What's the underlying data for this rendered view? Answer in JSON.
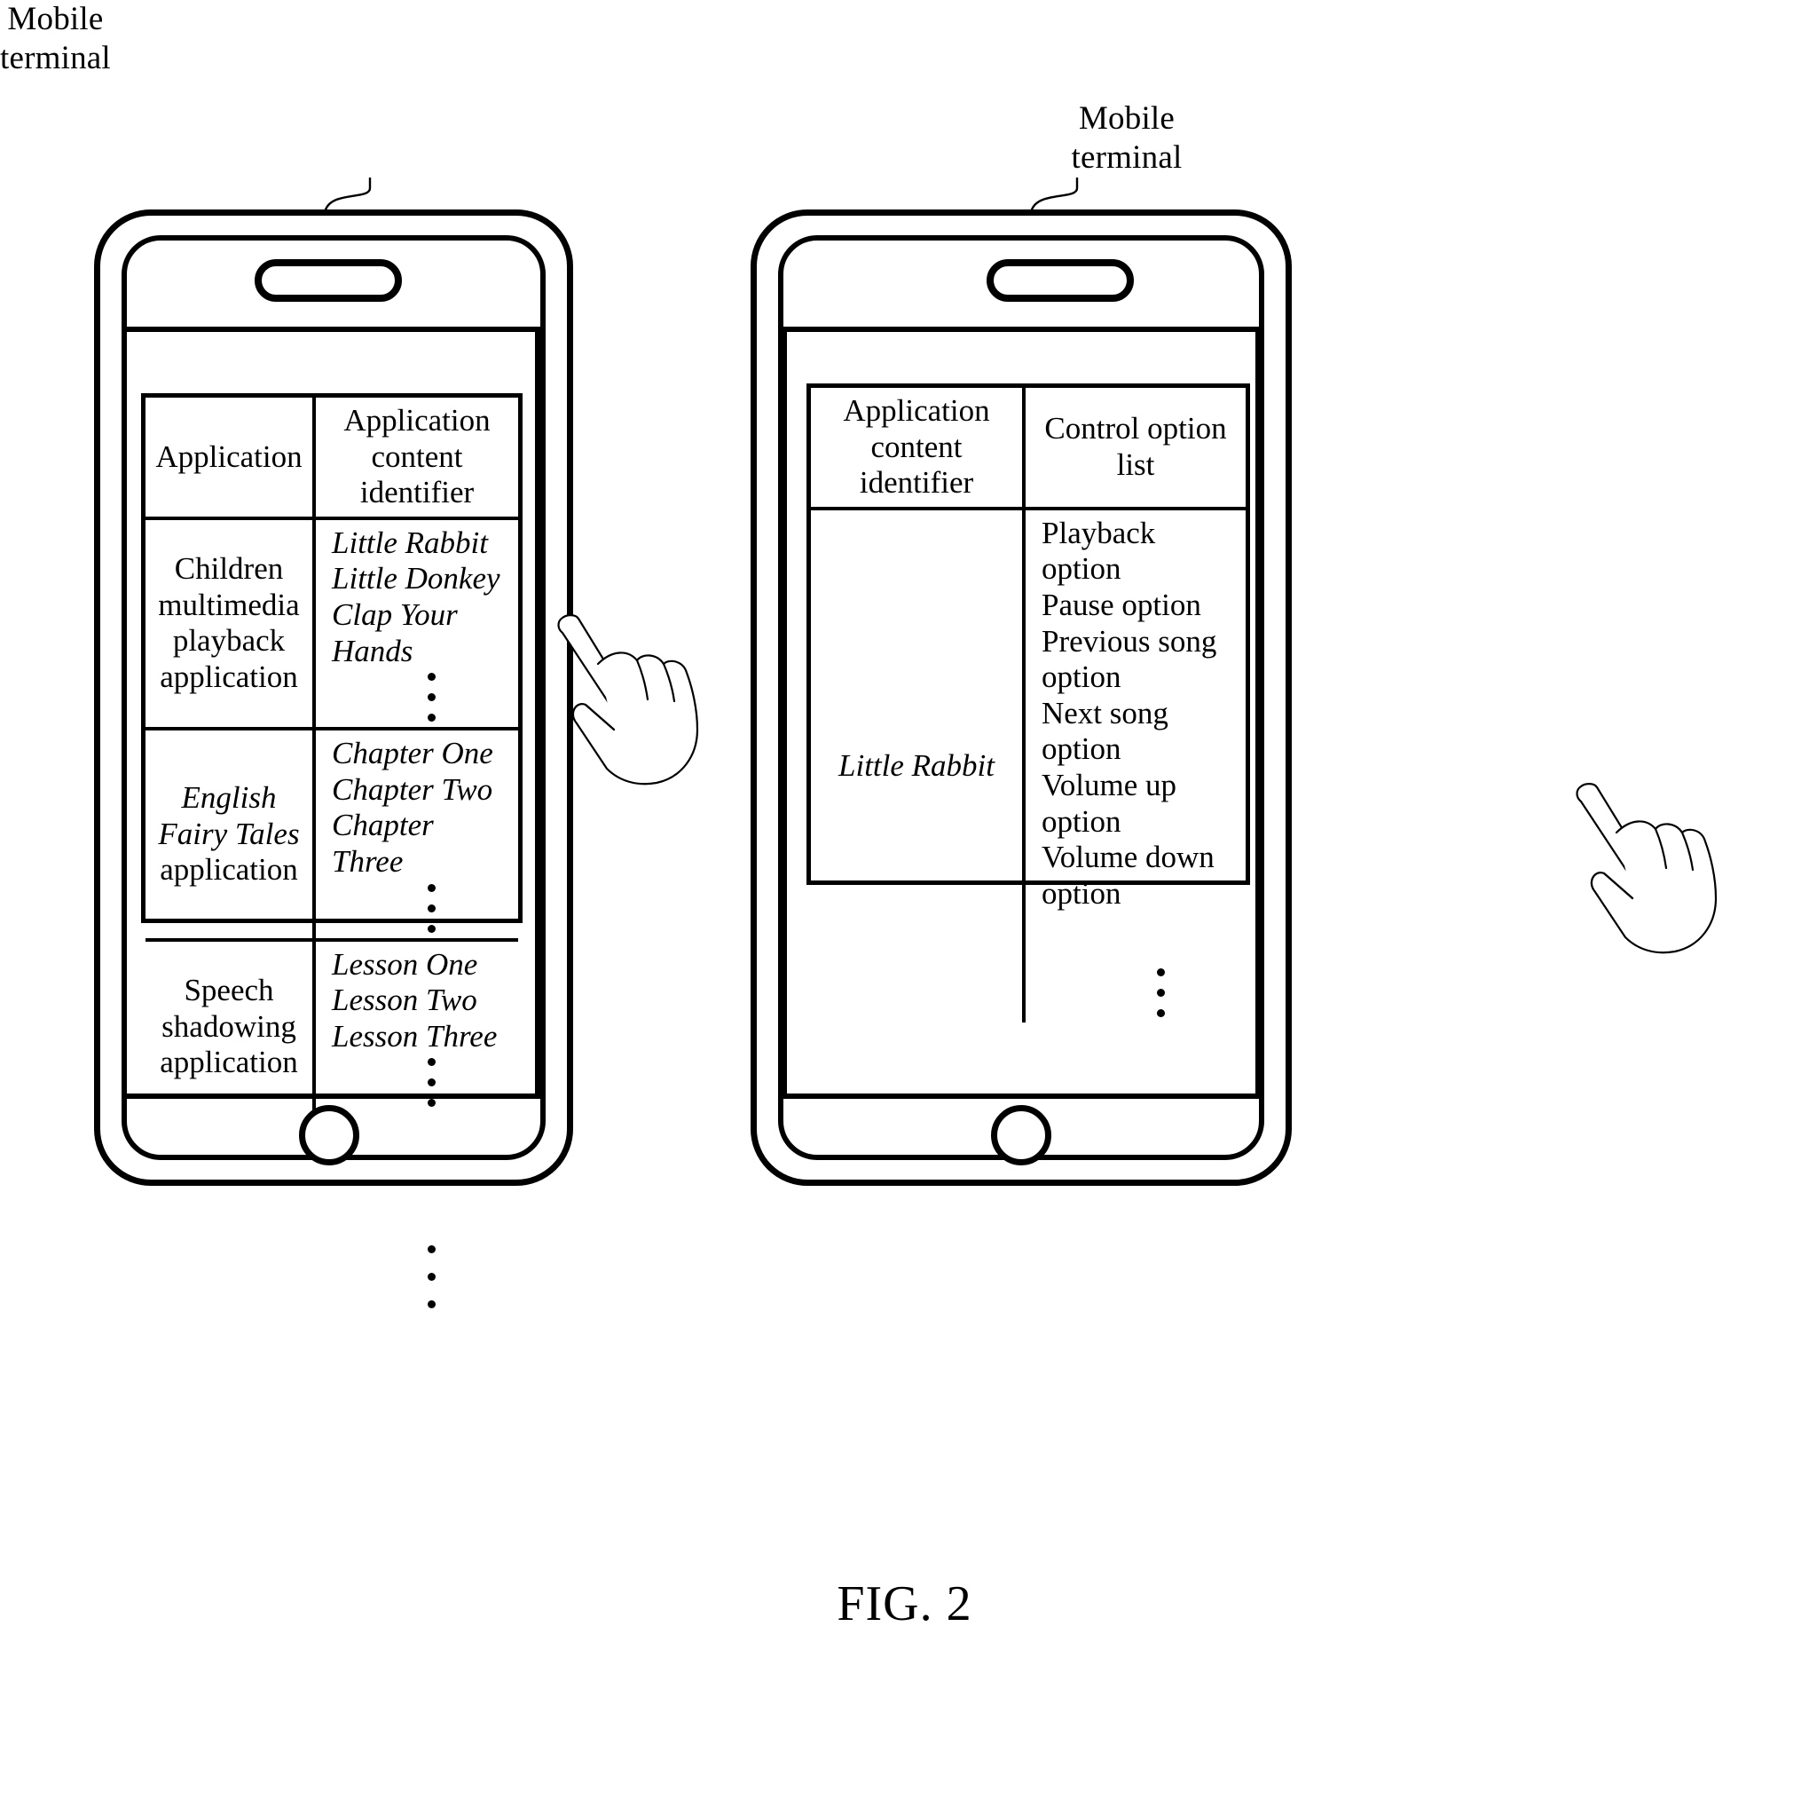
{
  "figure": {
    "caption": "FIG. 2",
    "arrow_label": "transition-arrow"
  },
  "left_phone": {
    "callout_label": "Mobile\nterminal",
    "table": {
      "headers": [
        "Application",
        "Application content\nidentifier"
      ],
      "rows": [
        {
          "application": "Children\nmultimedia\nplayback\napplication",
          "application_italic": "",
          "content_items": [
            "Little Rabbit",
            "Little Donkey",
            "Clap Your Hands"
          ],
          "has_ellipsis": true
        },
        {
          "application": "application",
          "application_italic": "English\nFairy Tales",
          "content_items": [
            "Chapter One",
            "Chapter Two",
            "Chapter Three"
          ],
          "has_ellipsis": true
        },
        {
          "application": "Speech\nshadowing\napplication",
          "application_italic": "",
          "content_items": [
            "Lesson One",
            "Lesson Two",
            "Lesson Three"
          ],
          "has_ellipsis": true
        }
      ],
      "below_table_ellipsis": true
    },
    "touch_target": "Little Rabbit"
  },
  "right_phone": {
    "callout_label": "Mobile\nterminal",
    "table": {
      "headers": [
        "Application\ncontent identifier",
        "Control option list"
      ],
      "row": {
        "content_identifier": "Little Rabbit",
        "control_options": [
          "Playback option",
          "Pause option",
          "Previous song option",
          "Next song option",
          "Volume up option",
          "Volume down option"
        ],
        "has_ellipsis": true
      }
    },
    "touch_target": "Previous song option"
  }
}
